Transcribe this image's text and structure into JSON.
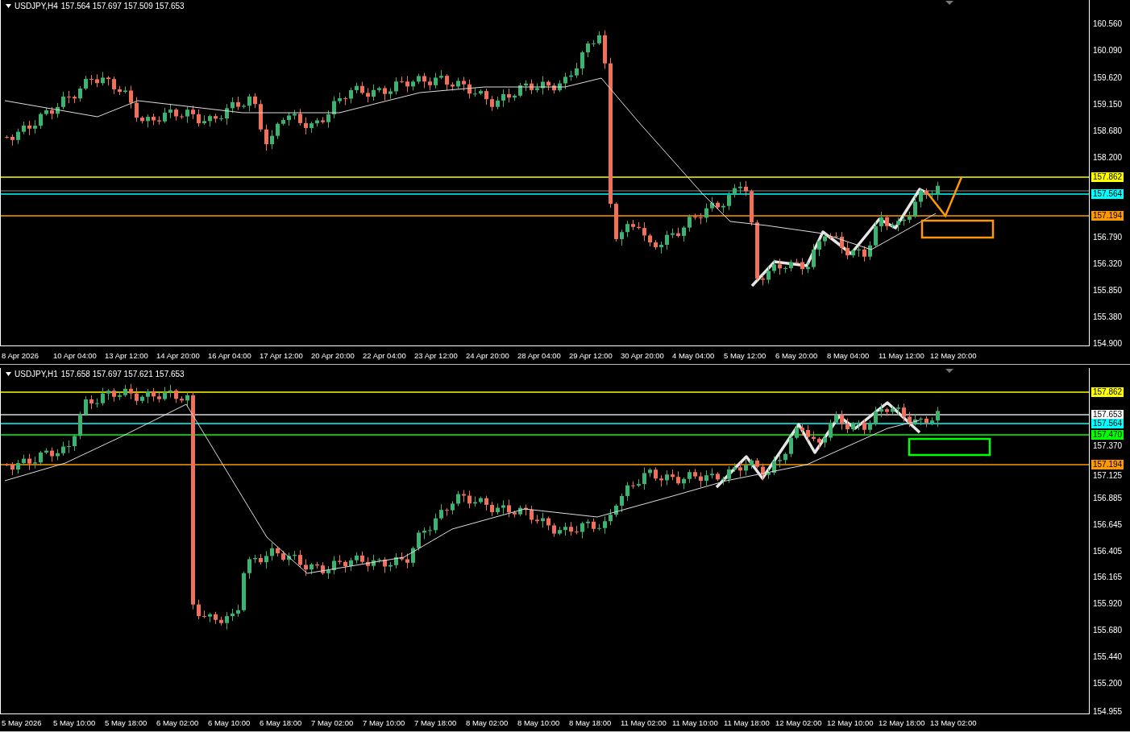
{
  "charts": [
    {
      "symbol": "USDJPY,H4",
      "ohlc": "157.564 157.697 157.509 157.653",
      "price_ticks": [
        "160.560",
        "160.090",
        "159.620",
        "159.150",
        "158.680",
        "158.200",
        "156.790",
        "156.320",
        "155.850",
        "155.380",
        "154.900"
      ],
      "price_tags": [
        {
          "label": "157.862",
          "color": "#ffff00"
        },
        {
          "label": "157.564",
          "color": "#00ffff"
        },
        {
          "label": "157.194",
          "color": "#ff9900"
        }
      ],
      "time_ticks": [
        "8 Apr 2026",
        "10 Apr 04:00",
        "13 Apr 12:00",
        "14 Apr 20:00",
        "16 Apr 04:00",
        "17 Apr 12:00",
        "20 Apr 20:00",
        "22 Apr 04:00",
        "23 Apr 12:00",
        "24 Apr 20:00",
        "28 Apr 04:00",
        "29 Apr 12:00",
        "30 Apr 20:00",
        "4 May 04:00",
        "5 May 12:00",
        "6 May 20:00",
        "8 May 04:00",
        "11 May 12:00",
        "12 May 20:00"
      ]
    },
    {
      "symbol": "USDJPY,H1",
      "ohlc": "157.658 157.697 157.621 157.653",
      "price_ticks": [
        "157.370",
        "157.125",
        "156.885",
        "156.645",
        "156.405",
        "156.165",
        "155.920",
        "155.680",
        "155.440",
        "155.200",
        "154.955"
      ],
      "price_tags": [
        {
          "label": "157.862",
          "color": "#ffff00"
        },
        {
          "label": "157.653",
          "color": "#ffffff"
        },
        {
          "label": "157.564",
          "color": "#00ffff"
        },
        {
          "label": "157.470",
          "color": "#00ff00"
        },
        {
          "label": "157.194",
          "color": "#ff9900"
        }
      ],
      "time_ticks": [
        "5 May 2026",
        "5 May 10:00",
        "5 May 18:00",
        "6 May 02:00",
        "6 May 10:00",
        "6 May 18:00",
        "7 May 02:00",
        "7 May 10:00",
        "7 May 18:00",
        "8 May 02:00",
        "8 May 10:00",
        "8 May 18:00",
        "11 May 02:00",
        "11 May 10:00",
        "11 May 18:00",
        "12 May 02:00",
        "12 May 10:00",
        "12 May 18:00",
        "13 May 02:00"
      ]
    }
  ]
}
